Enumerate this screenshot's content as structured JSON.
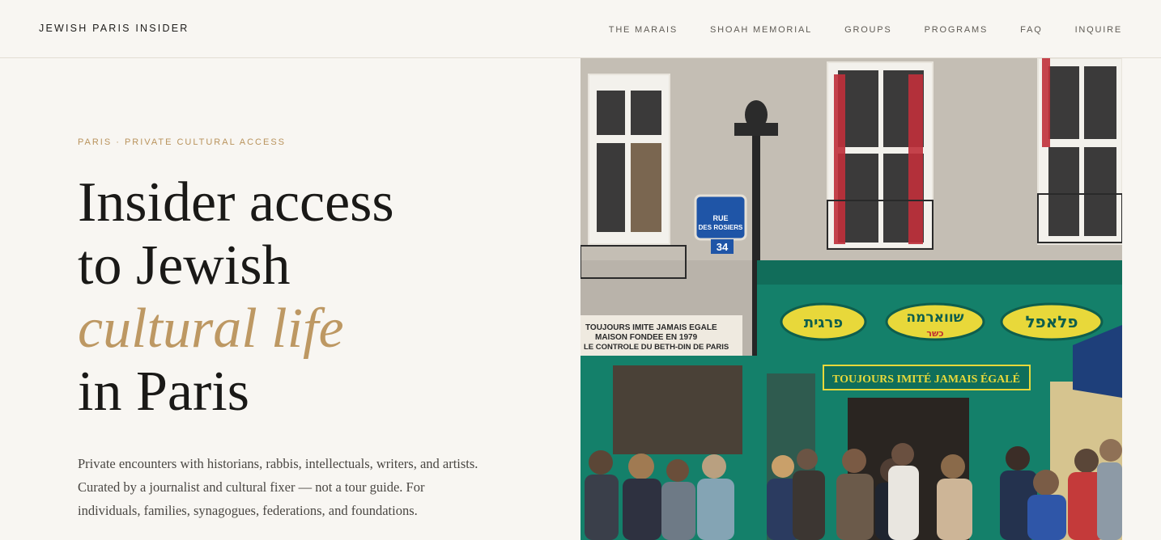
{
  "header": {
    "brand": "JEWISH PARIS INSIDER",
    "nav": [
      "THE MARAIS",
      "SHOAH MEMORIAL",
      "GROUPS",
      "PROGRAMS",
      "FAQ",
      "INQUIRE"
    ]
  },
  "hero": {
    "eyebrow": "PARIS · PRIVATE CULTURAL ACCESS",
    "headline": {
      "line1": "Insider access",
      "line2": "to Jewish",
      "line3_accent": "cultural life",
      "line4": "in Paris"
    },
    "lede": "Private encounters with historians, rabbis, intellectuals, writers, and artists. Curated by a journalist and cultural fixer — not a tour guide. For individuals, families, synagogues, federations, and foundations."
  },
  "photo": {
    "street_sign": [
      "RUE",
      "DES ROSIERS"
    ],
    "street_number": "34",
    "shop_banner": [
      "TOUJOURS IMITE JAMAIS EGALE",
      "MAISON FONDEE EN 1979",
      "LE CONTROLE DU BETH-DIN DE PARIS"
    ],
    "hebrew_signs": [
      "פלאפל",
      "שווארמה",
      "כשר",
      "פרגית"
    ],
    "shop_slogan": "TOUJOURS IMITÉ JAMAIS ÉGALÉ"
  },
  "colors": {
    "background": "#f8f6f2",
    "accent_gold": "#bd9863",
    "shop_green": "#14806a",
    "sign_yellow": "#e8d83a"
  }
}
